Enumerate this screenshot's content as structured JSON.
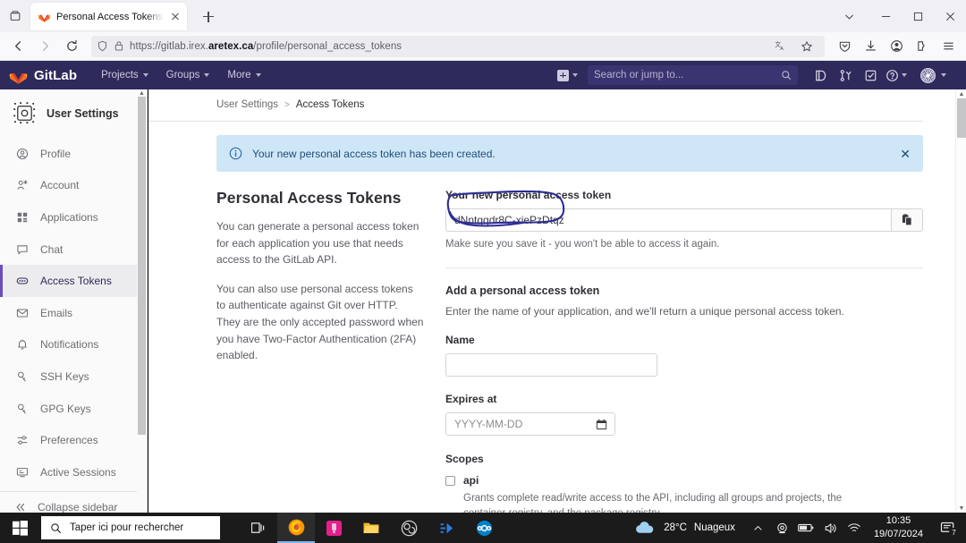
{
  "browser": {
    "tab": {
      "title": "Personal Access Tokens · User S",
      "favicon": "gitlab-fox-favicon"
    },
    "new_tab_label": "+",
    "url_prefix": "https://gitlab.irex.",
    "url_bold": "aretex.ca",
    "url_suffix": "/profile/personal_access_tokens",
    "window_controls": {
      "minimize": "–",
      "maximize": "▢",
      "close": "✕"
    }
  },
  "gitlab_nav": {
    "brand": "GitLab",
    "menu": [
      {
        "label": "Projects"
      },
      {
        "label": "Groups"
      },
      {
        "label": "More"
      }
    ],
    "search_placeholder": "Search or jump to..."
  },
  "sidebar": {
    "header": "User Settings",
    "items": [
      {
        "label": "Profile",
        "icon": "user-circle-icon",
        "active": false
      },
      {
        "label": "Account",
        "icon": "user-gear-icon",
        "active": false
      },
      {
        "label": "Applications",
        "icon": "grid-apps-icon",
        "active": false
      },
      {
        "label": "Chat",
        "icon": "chat-bubble-icon",
        "active": false
      },
      {
        "label": "Access Tokens",
        "icon": "token-icon",
        "active": true
      },
      {
        "label": "Emails",
        "icon": "envelope-icon",
        "active": false
      },
      {
        "label": "Notifications",
        "icon": "bell-icon",
        "active": false
      },
      {
        "label": "SSH Keys",
        "icon": "key-icon",
        "active": false
      },
      {
        "label": "GPG Keys",
        "icon": "key-icon",
        "active": false
      },
      {
        "label": "Preferences",
        "icon": "sliders-icon",
        "active": false
      },
      {
        "label": "Active Sessions",
        "icon": "monitor-icon",
        "active": false
      }
    ],
    "collapse_label": "Collapse sidebar"
  },
  "breadcrumb": {
    "root": "User Settings",
    "separator": ">",
    "current": "Access Tokens"
  },
  "alert": {
    "message": "Your new personal access token has been created.",
    "close_label": "✕",
    "bg_color": "#cfe6f7",
    "text_color": "#1f4e79"
  },
  "main": {
    "title": "Personal Access Tokens",
    "paragraph_1": "You can generate a personal access token for each application you use that needs access to the GitLab API.",
    "paragraph_2": "You can also use personal access tokens to authenticate against Git over HTTP. They are the only accepted password when you have Two-Factor Authentication (2FA) enabled.",
    "token_section_label": "Your new personal access token",
    "token_value": "dNntqqdr8C-xiePzDtqz",
    "token_hint": "Make sure you save it - you won't be able to access it again.",
    "copy_icon": "clipboard-copy-icon",
    "add_section_title": "Add a personal access token",
    "add_section_desc": "Enter the name of your application, and we'll return a unique personal access token.",
    "name_label": "Name",
    "name_value": "",
    "expires_label": "Expires at",
    "expires_placeholder": "YYYY-MM-DD",
    "calendar_icon": "calendar-icon",
    "scopes_label": "Scopes",
    "scopes": [
      {
        "name": "api",
        "checked": false,
        "description": "Grants complete read/write access to the API, including all groups and projects, the container registry, and the package registry."
      }
    ]
  },
  "annotation": {
    "type": "hand-drawn-circle",
    "color": "#2c2c96",
    "target": "token_value"
  },
  "taskbar": {
    "start_label": "start-button",
    "search_placeholder": "Taper ici pour rechercher",
    "apps": [
      {
        "name": "task-view-icon"
      },
      {
        "name": "firefox-icon",
        "active": true
      },
      {
        "name": "pink-app-icon"
      },
      {
        "name": "file-explorer-icon"
      },
      {
        "name": "obs-icon"
      },
      {
        "name": "blue-arrow-app-icon"
      },
      {
        "name": "nextcloud-icon"
      }
    ],
    "weather_temp": "28°C",
    "weather_desc": "Nuageux",
    "time": "10:35",
    "date": "19/07/2024",
    "notification_count": "7"
  }
}
